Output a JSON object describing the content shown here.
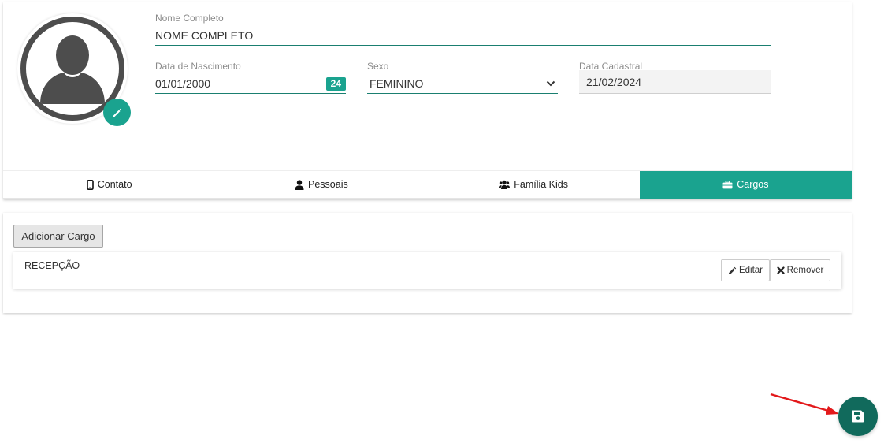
{
  "profile": {
    "nome": {
      "label": "Nome Completo",
      "value": "NOME COMPLETO"
    },
    "nascimento": {
      "label": "Data de Nascimento",
      "value": "01/01/2000",
      "age_badge": "24"
    },
    "sexo": {
      "label": "Sexo",
      "value": "FEMININO"
    },
    "cadastro": {
      "label": "Data Cadastral",
      "value": "21/02/2024"
    }
  },
  "tabs": [
    {
      "label": "Contato",
      "icon": "mobile-icon"
    },
    {
      "label": "Pessoais",
      "icon": "user-icon"
    },
    {
      "label": "Família Kids",
      "icon": "users-icon"
    },
    {
      "label": "Cargos",
      "icon": "briefcase-icon",
      "active": true
    }
  ],
  "cargos": {
    "add_label": "Adicionar Cargo",
    "items": [
      {
        "name": "RECEPÇÃO",
        "edit_label": "Editar",
        "remove_label": "Remover"
      }
    ]
  },
  "colors": {
    "accent": "#1aa38f",
    "save_fab": "#116a5c",
    "annotation_arrow": "#e3191b"
  },
  "icons": {
    "edit_photo": "pencil-icon",
    "save": "floppy-disk-icon"
  }
}
